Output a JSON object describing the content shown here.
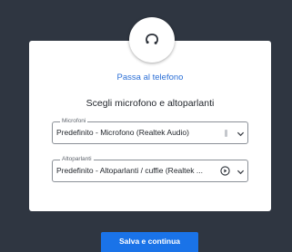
{
  "dialog": {
    "phone_icon": "phone-icon",
    "phone_link": "Passa al telefono",
    "title": "Scegli microfono e altoparlanti"
  },
  "microphone": {
    "label": "Microfoni",
    "value": "Predefinito - Microfono (Realtek Audio)",
    "level_icon": "mic-level-icon",
    "chevron_icon": "chevron-down-icon"
  },
  "speakers": {
    "label": "Altoparlanti",
    "value": "Predefinito - Altoparlanti / cuffie (Realtek ...",
    "play_icon": "play-circle-icon",
    "chevron_icon": "chevron-down-icon"
  },
  "footer": {
    "save_label": "Salva e continua"
  },
  "colors": {
    "background": "#2f3641",
    "card": "#ffffff",
    "accent": "#1a73e8",
    "link": "#2b6fd6"
  }
}
